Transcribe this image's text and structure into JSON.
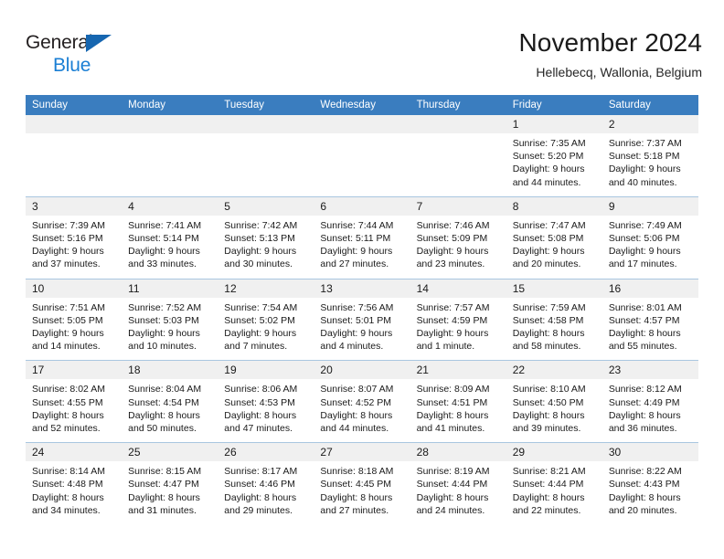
{
  "brand": {
    "line1": "General",
    "line2": "Blue",
    "triangle_color": "#1666b0",
    "blue_color": "#1b7fd4"
  },
  "header": {
    "title": "November 2024",
    "subtitle": "Hellebecq, Wallonia, Belgium"
  },
  "theme": {
    "header_blue": "#3a7dbf",
    "daynum_gray": "#f0f0f0",
    "row_separator": "#a9c6e0"
  },
  "weekday_headers": [
    "Sunday",
    "Monday",
    "Tuesday",
    "Wednesday",
    "Thursday",
    "Friday",
    "Saturday"
  ],
  "weeks": [
    [
      {
        "day": "",
        "lines": []
      },
      {
        "day": "",
        "lines": []
      },
      {
        "day": "",
        "lines": []
      },
      {
        "day": "",
        "lines": []
      },
      {
        "day": "",
        "lines": []
      },
      {
        "day": "1",
        "lines": [
          "Sunrise: 7:35 AM",
          "Sunset: 5:20 PM",
          "Daylight: 9 hours",
          "and 44 minutes."
        ]
      },
      {
        "day": "2",
        "lines": [
          "Sunrise: 7:37 AM",
          "Sunset: 5:18 PM",
          "Daylight: 9 hours",
          "and 40 minutes."
        ]
      }
    ],
    [
      {
        "day": "3",
        "lines": [
          "Sunrise: 7:39 AM",
          "Sunset: 5:16 PM",
          "Daylight: 9 hours",
          "and 37 minutes."
        ]
      },
      {
        "day": "4",
        "lines": [
          "Sunrise: 7:41 AM",
          "Sunset: 5:14 PM",
          "Daylight: 9 hours",
          "and 33 minutes."
        ]
      },
      {
        "day": "5",
        "lines": [
          "Sunrise: 7:42 AM",
          "Sunset: 5:13 PM",
          "Daylight: 9 hours",
          "and 30 minutes."
        ]
      },
      {
        "day": "6",
        "lines": [
          "Sunrise: 7:44 AM",
          "Sunset: 5:11 PM",
          "Daylight: 9 hours",
          "and 27 minutes."
        ]
      },
      {
        "day": "7",
        "lines": [
          "Sunrise: 7:46 AM",
          "Sunset: 5:09 PM",
          "Daylight: 9 hours",
          "and 23 minutes."
        ]
      },
      {
        "day": "8",
        "lines": [
          "Sunrise: 7:47 AM",
          "Sunset: 5:08 PM",
          "Daylight: 9 hours",
          "and 20 minutes."
        ]
      },
      {
        "day": "9",
        "lines": [
          "Sunrise: 7:49 AM",
          "Sunset: 5:06 PM",
          "Daylight: 9 hours",
          "and 17 minutes."
        ]
      }
    ],
    [
      {
        "day": "10",
        "lines": [
          "Sunrise: 7:51 AM",
          "Sunset: 5:05 PM",
          "Daylight: 9 hours",
          "and 14 minutes."
        ]
      },
      {
        "day": "11",
        "lines": [
          "Sunrise: 7:52 AM",
          "Sunset: 5:03 PM",
          "Daylight: 9 hours",
          "and 10 minutes."
        ]
      },
      {
        "day": "12",
        "lines": [
          "Sunrise: 7:54 AM",
          "Sunset: 5:02 PM",
          "Daylight: 9 hours",
          "and 7 minutes."
        ]
      },
      {
        "day": "13",
        "lines": [
          "Sunrise: 7:56 AM",
          "Sunset: 5:01 PM",
          "Daylight: 9 hours",
          "and 4 minutes."
        ]
      },
      {
        "day": "14",
        "lines": [
          "Sunrise: 7:57 AM",
          "Sunset: 4:59 PM",
          "Daylight: 9 hours",
          "and 1 minute."
        ]
      },
      {
        "day": "15",
        "lines": [
          "Sunrise: 7:59 AM",
          "Sunset: 4:58 PM",
          "Daylight: 8 hours",
          "and 58 minutes."
        ]
      },
      {
        "day": "16",
        "lines": [
          "Sunrise: 8:01 AM",
          "Sunset: 4:57 PM",
          "Daylight: 8 hours",
          "and 55 minutes."
        ]
      }
    ],
    [
      {
        "day": "17",
        "lines": [
          "Sunrise: 8:02 AM",
          "Sunset: 4:55 PM",
          "Daylight: 8 hours",
          "and 52 minutes."
        ]
      },
      {
        "day": "18",
        "lines": [
          "Sunrise: 8:04 AM",
          "Sunset: 4:54 PM",
          "Daylight: 8 hours",
          "and 50 minutes."
        ]
      },
      {
        "day": "19",
        "lines": [
          "Sunrise: 8:06 AM",
          "Sunset: 4:53 PM",
          "Daylight: 8 hours",
          "and 47 minutes."
        ]
      },
      {
        "day": "20",
        "lines": [
          "Sunrise: 8:07 AM",
          "Sunset: 4:52 PM",
          "Daylight: 8 hours",
          "and 44 minutes."
        ]
      },
      {
        "day": "21",
        "lines": [
          "Sunrise: 8:09 AM",
          "Sunset: 4:51 PM",
          "Daylight: 8 hours",
          "and 41 minutes."
        ]
      },
      {
        "day": "22",
        "lines": [
          "Sunrise: 8:10 AM",
          "Sunset: 4:50 PM",
          "Daylight: 8 hours",
          "and 39 minutes."
        ]
      },
      {
        "day": "23",
        "lines": [
          "Sunrise: 8:12 AM",
          "Sunset: 4:49 PM",
          "Daylight: 8 hours",
          "and 36 minutes."
        ]
      }
    ],
    [
      {
        "day": "24",
        "lines": [
          "Sunrise: 8:14 AM",
          "Sunset: 4:48 PM",
          "Daylight: 8 hours",
          "and 34 minutes."
        ]
      },
      {
        "day": "25",
        "lines": [
          "Sunrise: 8:15 AM",
          "Sunset: 4:47 PM",
          "Daylight: 8 hours",
          "and 31 minutes."
        ]
      },
      {
        "day": "26",
        "lines": [
          "Sunrise: 8:17 AM",
          "Sunset: 4:46 PM",
          "Daylight: 8 hours",
          "and 29 minutes."
        ]
      },
      {
        "day": "27",
        "lines": [
          "Sunrise: 8:18 AM",
          "Sunset: 4:45 PM",
          "Daylight: 8 hours",
          "and 27 minutes."
        ]
      },
      {
        "day": "28",
        "lines": [
          "Sunrise: 8:19 AM",
          "Sunset: 4:44 PM",
          "Daylight: 8 hours",
          "and 24 minutes."
        ]
      },
      {
        "day": "29",
        "lines": [
          "Sunrise: 8:21 AM",
          "Sunset: 4:44 PM",
          "Daylight: 8 hours",
          "and 22 minutes."
        ]
      },
      {
        "day": "30",
        "lines": [
          "Sunrise: 8:22 AM",
          "Sunset: 4:43 PM",
          "Daylight: 8 hours",
          "and 20 minutes."
        ]
      }
    ]
  ]
}
